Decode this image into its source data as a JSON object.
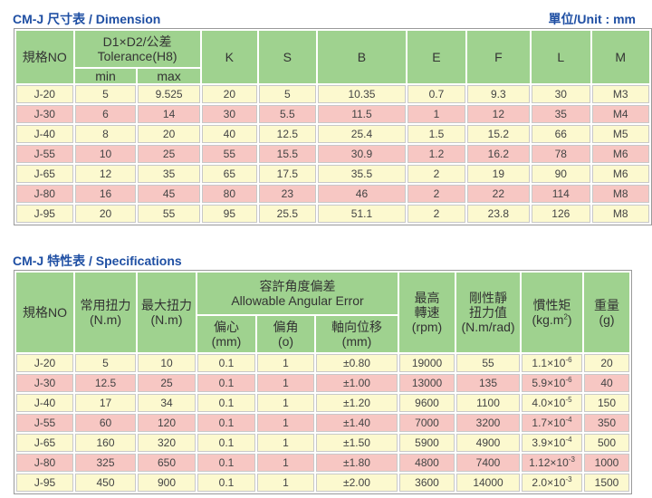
{
  "dimension": {
    "title": "CM-J 尺寸表 /  Dimension",
    "unit": "單位/Unit : mm",
    "headers": {
      "model": "規格NO",
      "d1d2_line1": "D1×D2/公差",
      "d1d2_line2": "Tolerance(H8)",
      "min": "min",
      "max": "max",
      "k": "K",
      "s": "S",
      "b": "B",
      "e": "E",
      "f": "F",
      "l": "L",
      "m": "M"
    },
    "rows": [
      {
        "model": "J-20",
        "min": "5",
        "max": "9.525",
        "k": "20",
        "s": "5",
        "b": "10.35",
        "e": "0.7",
        "f": "9.3",
        "l": "30",
        "m": "M3"
      },
      {
        "model": "J-30",
        "min": "6",
        "max": "14",
        "k": "30",
        "s": "5.5",
        "b": "11.5",
        "e": "1",
        "f": "12",
        "l": "35",
        "m": "M4"
      },
      {
        "model": "J-40",
        "min": "8",
        "max": "20",
        "k": "40",
        "s": "12.5",
        "b": "25.4",
        "e": "1.5",
        "f": "15.2",
        "l": "66",
        "m": "M5"
      },
      {
        "model": "J-55",
        "min": "10",
        "max": "25",
        "k": "55",
        "s": "15.5",
        "b": "30.9",
        "e": "1.2",
        "f": "16.2",
        "l": "78",
        "m": "M6"
      },
      {
        "model": "J-65",
        "min": "12",
        "max": "35",
        "k": "65",
        "s": "17.5",
        "b": "35.5",
        "e": "2",
        "f": "19",
        "l": "90",
        "m": "M6"
      },
      {
        "model": "J-80",
        "min": "16",
        "max": "45",
        "k": "80",
        "s": "23",
        "b": "46",
        "e": "2",
        "f": "22",
        "l": "114",
        "m": "M8"
      },
      {
        "model": "J-95",
        "min": "20",
        "max": "55",
        "k": "95",
        "s": "25.5",
        "b": "51.1",
        "e": "2",
        "f": "23.8",
        "l": "126",
        "m": "M8"
      }
    ]
  },
  "specifications": {
    "title": "CM-J 特性表 /  Specifications",
    "headers": {
      "model": "規格NO",
      "rated_torque_1": "常用扭力",
      "rated_torque_2": "(N.m)",
      "max_torque_1": "最大扭力",
      "max_torque_2": "(N.m)",
      "misalign_1": "容許角度偏差",
      "misalign_2": "Allowable Angular Error",
      "radial_1": "偏心",
      "radial_2": "(mm)",
      "angular_1": "偏角",
      "angular_2": "(o)",
      "axial_1": "軸向位移",
      "axial_2": "(mm)",
      "speed_1": "最高",
      "speed_2": "轉速",
      "speed_3": "(rpm)",
      "stiff_1": "剛性靜",
      "stiff_2": "扭力值",
      "stiff_3": "(N.m/rad)",
      "inertia_1": "慣性矩",
      "inertia_2": "(kg.m",
      "inertia_sup": "2",
      "inertia_3": ")",
      "weight_1": "重量",
      "weight_2": "(g)"
    },
    "rows": [
      {
        "model": "J-20",
        "rated": "5",
        "max": "10",
        "radial": "0.1",
        "angular": "1",
        "axial": "±0.80",
        "speed": "19000",
        "stiffness": "55",
        "inertia_base": "1.1×10",
        "inertia_exp": "-6",
        "weight": "20"
      },
      {
        "model": "J-30",
        "rated": "12.5",
        "max": "25",
        "radial": "0.1",
        "angular": "1",
        "axial": "±1.00",
        "speed": "13000",
        "stiffness": "135",
        "inertia_base": "5.9×10",
        "inertia_exp": "-6",
        "weight": "40"
      },
      {
        "model": "J-40",
        "rated": "17",
        "max": "34",
        "radial": "0.1",
        "angular": "1",
        "axial": "±1.20",
        "speed": "9600",
        "stiffness": "1100",
        "inertia_base": "4.0×10",
        "inertia_exp": "-5",
        "weight": "150"
      },
      {
        "model": "J-55",
        "rated": "60",
        "max": "120",
        "radial": "0.1",
        "angular": "1",
        "axial": "±1.40",
        "speed": "7000",
        "stiffness": "3200",
        "inertia_base": "1.7×10",
        "inertia_exp": "-4",
        "weight": "350"
      },
      {
        "model": "J-65",
        "rated": "160",
        "max": "320",
        "radial": "0.1",
        "angular": "1",
        "axial": "±1.50",
        "speed": "5900",
        "stiffness": "4900",
        "inertia_base": "3.9×10",
        "inertia_exp": "-4",
        "weight": "500"
      },
      {
        "model": "J-80",
        "rated": "325",
        "max": "650",
        "radial": "0.1",
        "angular": "1",
        "axial": "±1.80",
        "speed": "4800",
        "stiffness": "7400",
        "inertia_base": "1.12×10",
        "inertia_exp": "-3",
        "weight": "1000"
      },
      {
        "model": "J-95",
        "rated": "450",
        "max": "900",
        "radial": "0.1",
        "angular": "1",
        "axial": "±2.00",
        "speed": "3600",
        "stiffness": "14000",
        "inertia_base": "2.0×10",
        "inertia_exp": "-3",
        "weight": "1500"
      }
    ]
  }
}
